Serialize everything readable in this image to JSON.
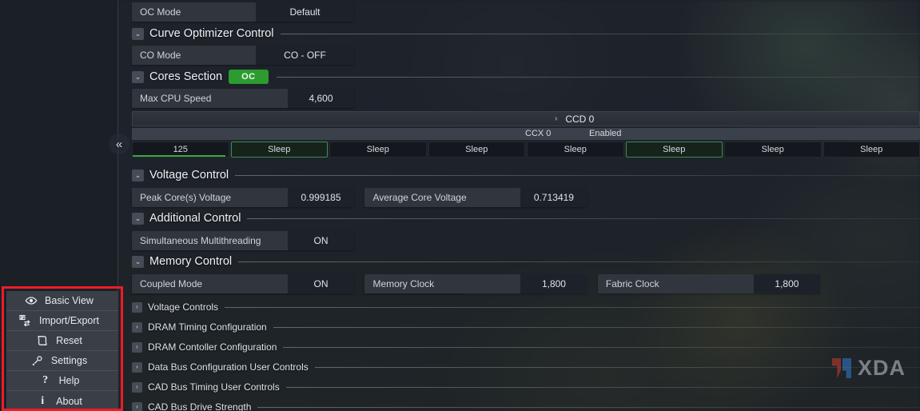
{
  "app": {
    "collapse_icon": "«"
  },
  "sidebar": {
    "items": [
      {
        "label": "Basic View",
        "icon": "eye-icon"
      },
      {
        "label": "Import/Export",
        "icon": "import-export-icon"
      },
      {
        "label": "Reset",
        "icon": "reset-icon"
      },
      {
        "label": "Settings",
        "icon": "settings-icon"
      },
      {
        "label": "Help",
        "icon": "question-mark-icon",
        "glyph": "?"
      },
      {
        "label": "About",
        "icon": "info-icon",
        "glyph": "i"
      }
    ]
  },
  "main": {
    "oc_mode": {
      "label": "OC Mode",
      "value": "Default"
    },
    "curve_optimizer": {
      "title": "Curve Optimizer Control",
      "co_mode": {
        "label": "CO Mode",
        "value": "CO - OFF"
      }
    },
    "cores_section": {
      "title": "Cores Section",
      "badge": "OC",
      "max_cpu_speed": {
        "label": "Max CPU Speed",
        "value": "4,600"
      }
    },
    "ccd": {
      "name": "CCD 0",
      "chevron": "›",
      "ccx_name": "CCX 0",
      "ccx_state": "Enabled",
      "cores": [
        {
          "value": "125",
          "active": false,
          "load_pct": 97
        },
        {
          "value": "Sleep",
          "active": true,
          "load_pct": 0
        },
        {
          "value": "Sleep",
          "active": false,
          "load_pct": 0
        },
        {
          "value": "Sleep",
          "active": false,
          "load_pct": 0
        },
        {
          "value": "Sleep",
          "active": false,
          "load_pct": 0
        },
        {
          "value": "Sleep",
          "active": true,
          "load_pct": 0
        },
        {
          "value": "Sleep",
          "active": false,
          "load_pct": 0
        },
        {
          "value": "Sleep",
          "active": false,
          "load_pct": 0
        }
      ]
    },
    "voltage_control": {
      "title": "Voltage Control",
      "peak": {
        "label": "Peak Core(s) Voltage",
        "value": "0.999185"
      },
      "average": {
        "label": "Average Core Voltage",
        "value": "0.713419"
      }
    },
    "additional_control": {
      "title": "Additional Control",
      "smt": {
        "label": "Simultaneous Multithreading",
        "value": "ON"
      }
    },
    "memory_control": {
      "title": "Memory Control",
      "coupled": {
        "label": "Coupled Mode",
        "value": "ON"
      },
      "memory_clock": {
        "label": "Memory Clock",
        "value": "1,800"
      },
      "fabric_clock": {
        "label": "Fabric Clock",
        "value": "1,800"
      }
    },
    "collapsed_sections": [
      {
        "title": "Voltage Controls"
      },
      {
        "title": "DRAM Timing Configuration"
      },
      {
        "title": "DRAM Contoller Configuration"
      },
      {
        "title": "Data Bus Configuration User Controls"
      },
      {
        "title": "CAD Bus Timing User Controls"
      },
      {
        "title": "CAD Bus Drive Strength"
      }
    ],
    "chevron_collapsed": "›",
    "chevron_expanded": "⌄"
  },
  "watermark": {
    "text": "XDA"
  },
  "colors": {
    "accent_green": "#2c9b30",
    "highlight_red": "#ee1c25",
    "panel": "#31363e",
    "value_bg": "#1d222a"
  }
}
